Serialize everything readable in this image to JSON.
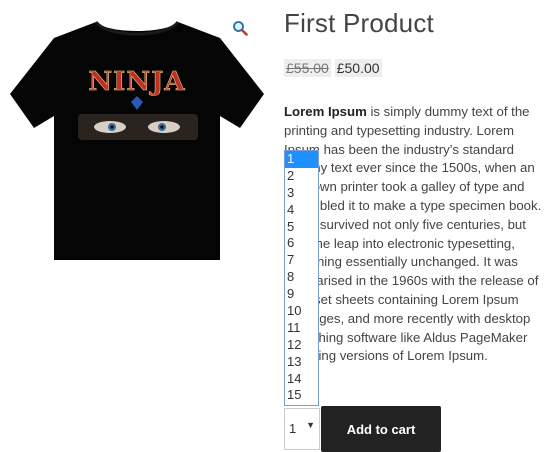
{
  "product": {
    "title": "First Product",
    "price_old": "£55.00",
    "price_new": "£50.00",
    "description_lead": "Lorem Ipsum",
    "description_rest": " is simply dummy text of the printing and typesetting industry. Lorem Ipsum has been the industry’s standard dummy text ever since the 1500s, when an unknown printer took a galley of type and scrambled it to make a type specimen book. It has survived not only five centuries, but also the leap into electronic typesetting, remaining essentially unchanged. It was popularised in the 1960s with the release of Letraset sheets containing Lorem Ipsum passages, and more recently with desktop publishing software like Aldus PageMaker including versions of Lorem Ipsum.",
    "image_text": "NINJA"
  },
  "quantity": {
    "selected": "1",
    "arrow": "▼",
    "options": [
      "1",
      "2",
      "3",
      "4",
      "5",
      "6",
      "7",
      "8",
      "9",
      "10",
      "11",
      "12",
      "13",
      "14",
      "15"
    ]
  },
  "cart": {
    "button_label": "Add to cart"
  },
  "icons": {
    "zoom": "magnifier-icon"
  },
  "colors": {
    "button_bg": "#222222",
    "selected_option": "#1e90ff"
  }
}
